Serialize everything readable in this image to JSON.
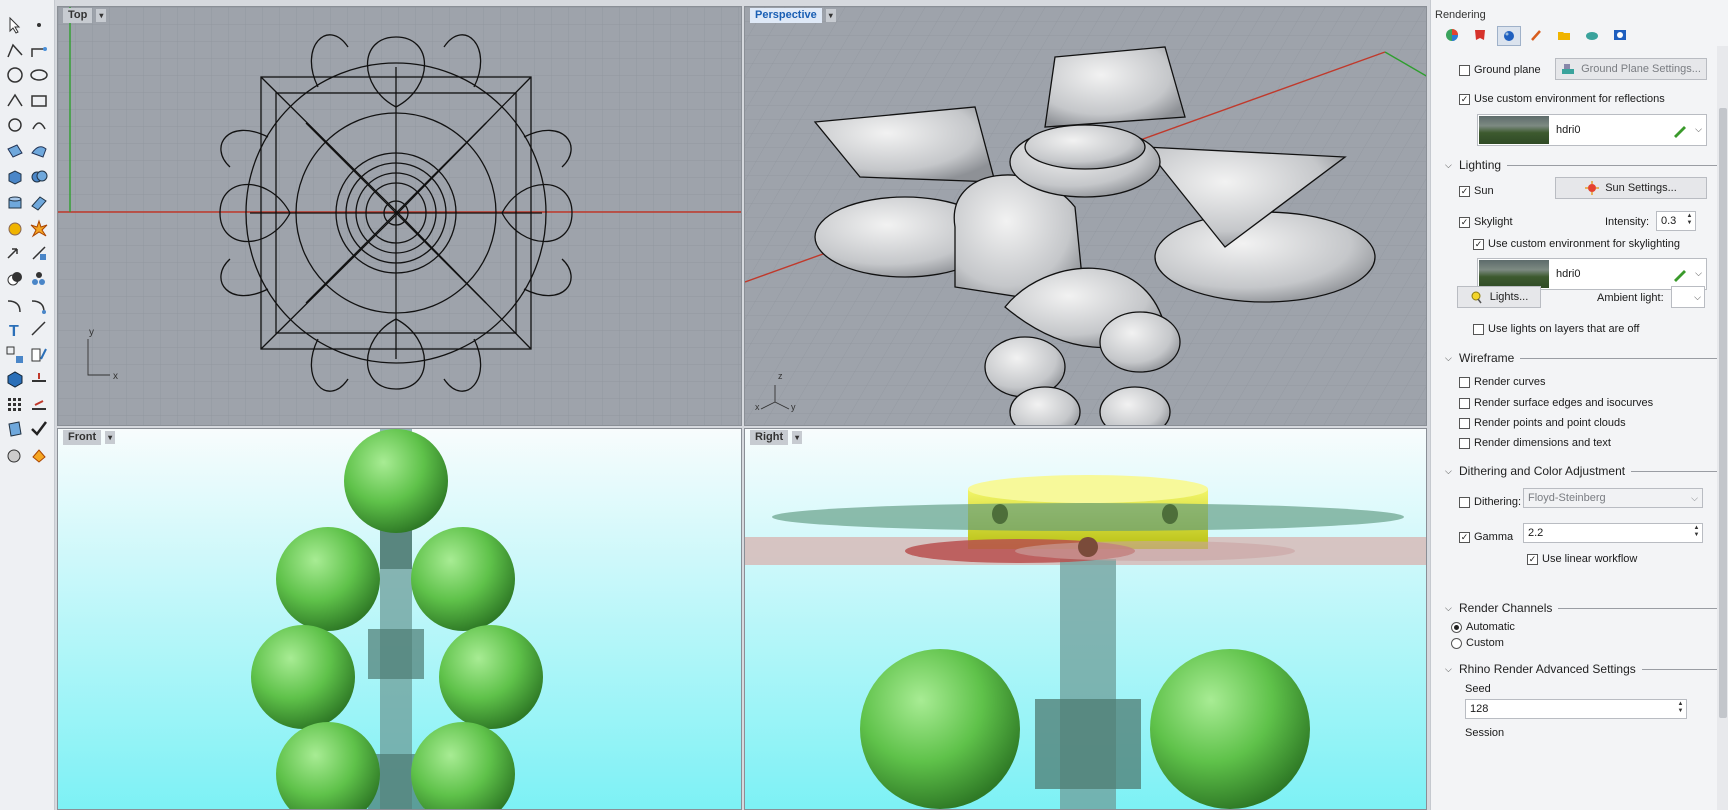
{
  "viewports": {
    "top": {
      "label": "Top",
      "axis_x": "x",
      "axis_y": "y"
    },
    "perspective": {
      "label": "Perspective",
      "axis_x": "x",
      "axis_y": "y",
      "axis_z": "z"
    },
    "front": {
      "label": "Front"
    },
    "right": {
      "label": "Right"
    }
  },
  "panel": {
    "title": "Rendering",
    "tabs": [
      "environment-icon",
      "material-icon",
      "render-icon",
      "brush-icon",
      "folder-icon",
      "ground-icon",
      "help-icon"
    ],
    "ground_plane": {
      "label": "Ground plane",
      "checked": false,
      "button": "Ground Plane Settings..."
    },
    "custom_env_reflections": {
      "label": "Use custom environment for reflections",
      "checked": true
    },
    "env1": {
      "name": "hdri0"
    },
    "lighting": {
      "title": "Lighting",
      "sun": {
        "label": "Sun",
        "checked": true,
        "button": "Sun Settings..."
      },
      "skylight": {
        "label": "Skylight",
        "checked": true,
        "intensity_label": "Intensity:",
        "intensity": "0.3"
      },
      "custom_env_skylighting": {
        "label": "Use custom environment for skylighting",
        "checked": true
      },
      "env2": {
        "name": "hdri0"
      },
      "lights_button": "Lights...",
      "ambient_label": "Ambient light:",
      "lights_on_layers_off": {
        "label": "Use lights on layers that are off",
        "checked": false
      }
    },
    "wireframe": {
      "title": "Wireframe",
      "render_curves": "Render curves",
      "render_surface_edges": "Render surface edges and isocurves",
      "render_points": "Render points and point clouds",
      "render_dimensions": "Render dimensions and text"
    },
    "dithering": {
      "title": "Dithering and Color Adjustment",
      "dithering_label": "Dithering:",
      "dithering_value": "Floyd-Steinberg",
      "gamma_label": "Gamma",
      "gamma_value": "2.2",
      "linear_workflow": "Use linear workflow"
    },
    "render_channels": {
      "title": "Render Channels",
      "automatic": "Automatic",
      "custom": "Custom"
    },
    "advanced": {
      "title": "Rhino Render Advanced Settings",
      "seed_label": "Seed",
      "seed_value": "128",
      "session_label": "Session"
    }
  },
  "colors": {
    "x_axis": "#c0392b",
    "y_axis": "#2e9e2e",
    "active_tab": "#1a5fb4",
    "sphere_green": "#5fc24a",
    "yellow_disc": "#e6ec1e"
  }
}
